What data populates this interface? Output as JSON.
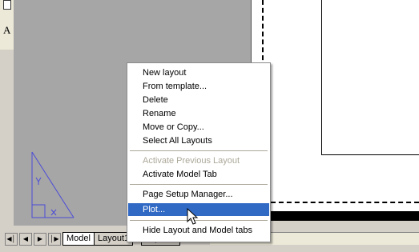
{
  "context_menu": {
    "items": [
      {
        "label": "New layout",
        "enabled": true
      },
      {
        "label": "From template...",
        "enabled": true
      },
      {
        "label": "Delete",
        "enabled": true
      },
      {
        "label": "Rename",
        "enabled": true
      },
      {
        "label": "Move or Copy...",
        "enabled": true
      },
      {
        "label": "Select All Layouts",
        "enabled": true
      },
      {
        "label": "Activate Previous Layout",
        "enabled": false
      },
      {
        "label": "Activate Model Tab",
        "enabled": true
      },
      {
        "label": "Page Setup Manager...",
        "enabled": true
      },
      {
        "label": "Plot...",
        "enabled": true,
        "highlighted": true
      },
      {
        "label": "Hide Layout and Model tabs",
        "enabled": true
      }
    ]
  },
  "tabs": {
    "items": [
      {
        "label": "Model"
      },
      {
        "label": "Layout1"
      },
      {
        "label": "Layout2"
      }
    ]
  },
  "toolbar": {
    "icon_letter": "A"
  },
  "colors": {
    "highlight": "#316ac5",
    "disabled_text": "#aca899",
    "canvas_background": "#a6a6a6",
    "ucs_icon": "#4b4bd8"
  },
  "icons": {
    "nav_first": "first-tab-icon",
    "nav_prev": "prev-tab-icon",
    "nav_next": "next-tab-icon",
    "nav_last": "last-tab-icon",
    "ucs": "ucs-icon",
    "cursor": "arrow-cursor-icon"
  }
}
